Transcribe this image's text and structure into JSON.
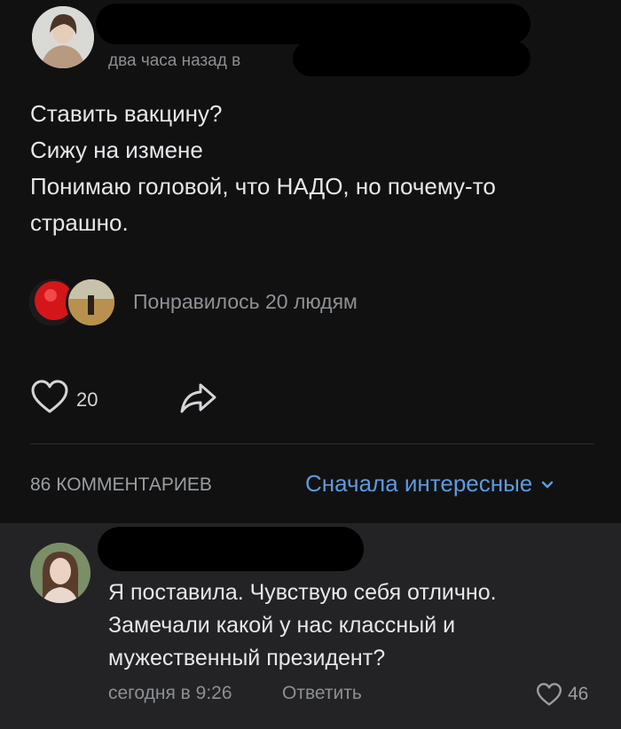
{
  "post": {
    "time_label": "два часа назад в",
    "lines": [
      "Ставить вакцину?",
      "Сижу на измене",
      "Понимаю головой, что НАДО, но почему-то",
      "страшно."
    ],
    "liked_by_text": "Понравилось 20 людям",
    "like_count": "20",
    "icons": {
      "like": "heart-outline-icon",
      "share": "share-arrow-icon"
    }
  },
  "comments_header": {
    "count_label": "86 КОММЕНТАРИЕВ",
    "sort_label": "Сначала интересные",
    "sort_icon": "chevron-down-icon"
  },
  "comment": {
    "lines": [
      "Я поставила. Чувствую себя отлично.",
      "Замечали какой у нас классный и",
      "мужественный президент?"
    ],
    "time": "сегодня в 9:26",
    "reply_label": "Ответить",
    "like_count": "46"
  },
  "colors": {
    "post_background": "#111111",
    "comment_background": "#232325",
    "accent_link": "#5d9adf",
    "muted_text": "#8c8f94",
    "primary_text": "#e6e7ea"
  }
}
